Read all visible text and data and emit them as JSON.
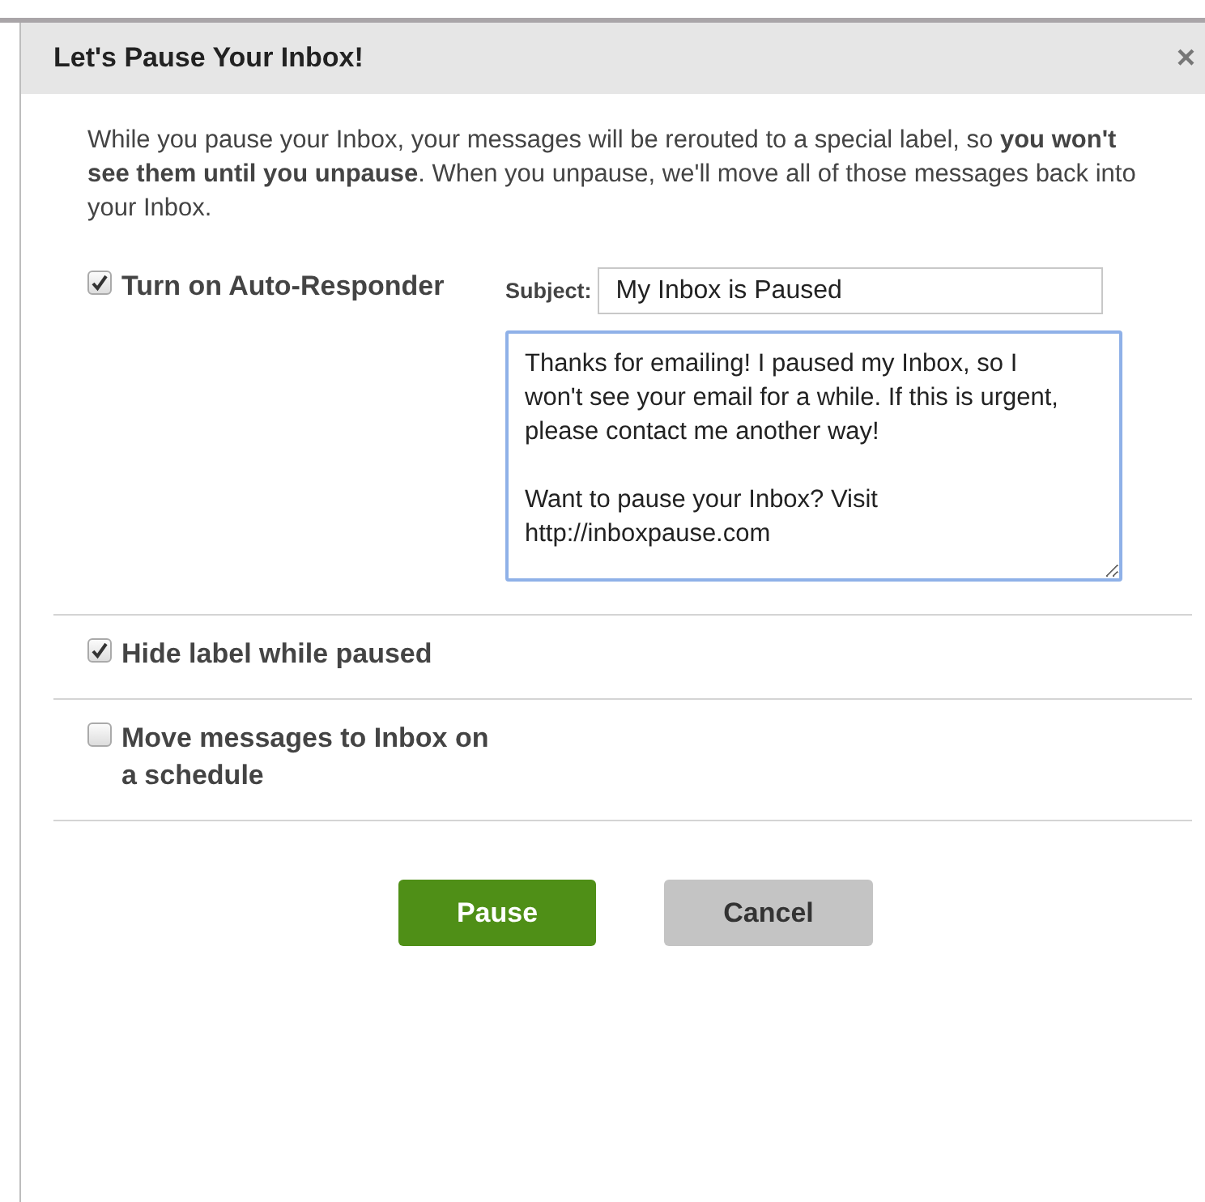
{
  "dialog": {
    "title": "Let's Pause Your Inbox!",
    "close": "×",
    "intro": "While you pause your Inbox, your messages will be rerouted to a special label, so **you won't see them until you unpause**. When you unpause, we'll move all of those messages back into your Inbox.",
    "options": [
      {
        "kind": "responder",
        "label": "Turn on Auto-Responder",
        "checked": true,
        "subject_label": "Subject:",
        "subject": "My Inbox is Paused",
        "message": "Thanks for emailing! I paused my Inbox, so I won't see your email for a while. If this is urgent, please contact me another way!\n\nWant to pause your Inbox? Visit http://inboxpause.com"
      },
      {
        "kind": "checkbox",
        "label": "Hide label while paused",
        "checked": true
      },
      {
        "kind": "checkbox",
        "label": "Move messages to Inbox on a schedule",
        "checked": false
      }
    ],
    "buttons": [
      {
        "label": "Pause",
        "kind": "primary"
      },
      {
        "label": "Cancel",
        "kind": "secondary"
      }
    ]
  }
}
